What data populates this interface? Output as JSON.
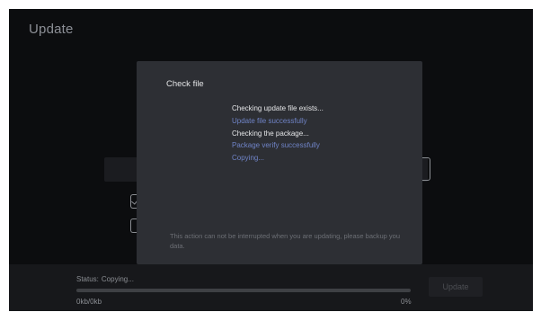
{
  "page": {
    "title": "Update"
  },
  "dialog": {
    "title": "Check file",
    "log": [
      {
        "text": "Checking update file exists...",
        "tone": "white"
      },
      {
        "text": "Update file successfully",
        "tone": "blue"
      },
      {
        "text": "Checking the package...",
        "tone": "white"
      },
      {
        "text": "Package verify successfully",
        "tone": "blue"
      },
      {
        "text": "Copying...",
        "tone": "blue"
      }
    ],
    "note": "This action can not be interrupted when you are updating, please backup you data."
  },
  "status": {
    "label": "Status:",
    "value": "Copying...",
    "size": "0kb/0kb",
    "percent_text": "0%",
    "progress_fraction": 0.0
  },
  "update_button": {
    "label": "Update",
    "enabled": false
  },
  "background_options": {
    "checkbox_1_checked": true,
    "checkbox_2_checked": false
  },
  "colors": {
    "background": "#0c0d0f",
    "dialog": "#2d2f34",
    "success_text": "#6f83c6",
    "primary_text": "#e4e5e7",
    "muted_text": "#8a8d92"
  }
}
